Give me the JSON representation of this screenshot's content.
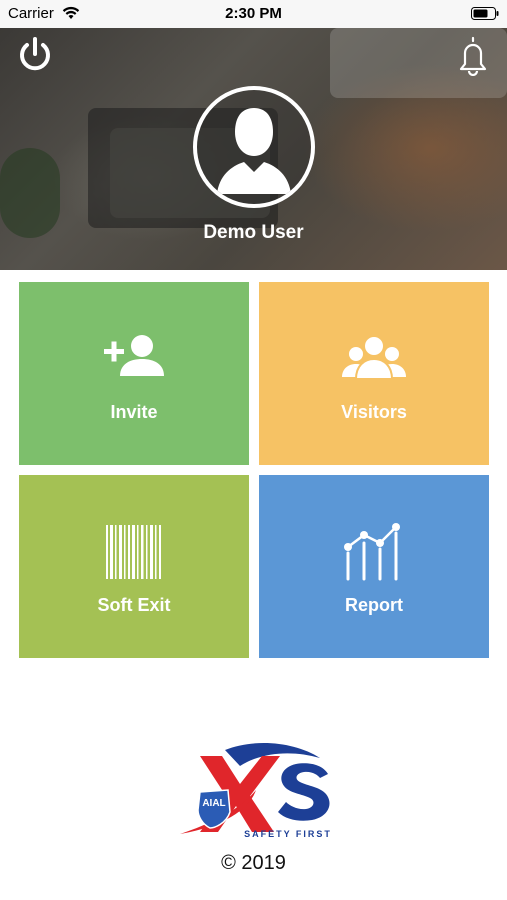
{
  "status_bar": {
    "carrier": "Carrier",
    "time": "2:30 PM"
  },
  "header": {
    "user_name": "Demo User"
  },
  "tiles": [
    {
      "label": "Invite",
      "icon": "add-user-icon",
      "color": "#7dbf6c"
    },
    {
      "label": "Visitors",
      "icon": "group-icon",
      "color": "#f6c264"
    },
    {
      "label": "Soft Exit",
      "icon": "barcode-icon",
      "color": "#a4c154"
    },
    {
      "label": "Report",
      "icon": "line-chart-icon",
      "color": "#5b97d6"
    }
  ],
  "footer": {
    "logo_badge": "AIAL",
    "logo_text": "XS",
    "logo_tagline": "SAFETY FIRST",
    "copyright": "© 2019"
  },
  "colors": {
    "brand_red": "#e0262b",
    "brand_blue": "#1d3f96",
    "status_bar_bg": "#f7f7f7"
  }
}
